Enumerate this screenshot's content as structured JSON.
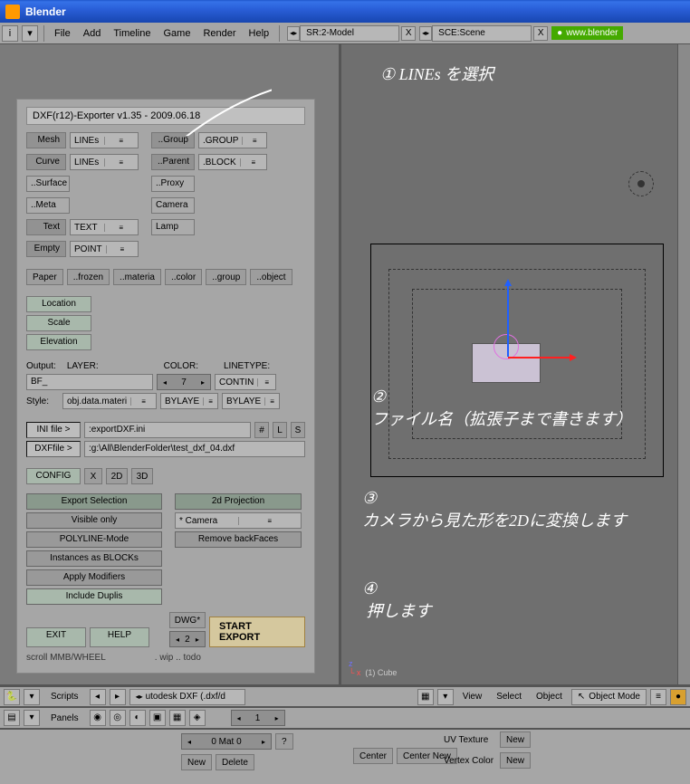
{
  "titlebar": {
    "title": "Blender"
  },
  "menu": {
    "items": [
      "File",
      "Add",
      "Timeline",
      "Game",
      "Render",
      "Help"
    ],
    "ibtn": "i",
    "scene1": "SR:2-Model",
    "scene2": "SCE:Scene",
    "url": "www.blender"
  },
  "panel": {
    "title": "DXF(r12)-Exporter  v1.35 - 2009.06.18",
    "mesh": "Mesh",
    "mesh_v": "LINEs",
    "curve": "Curve",
    "curve_v": "LINEs",
    "surface": "..Surface",
    "meta": "..Meta",
    "text": "Text",
    "text_v": "TEXT",
    "empty": "Empty",
    "empty_v": "POINT",
    "group": "..Group",
    "group_v": ".GROUP",
    "parent": "..Parent",
    "parent_v": ".BLOCK",
    "proxy": "..Proxy",
    "camera": "Camera",
    "lamp": "Lamp",
    "paper": "Paper",
    "frozen": "..frozen",
    "materia": "..materia",
    "color": "..color",
    "groupb": "..group",
    "object": "..object",
    "loc": "Location",
    "sca": "Scale",
    "ele": "Elevation",
    "out_lbl": "Output:",
    "layer": "LAYER:",
    "color_h": "COLOR:",
    "linetype": "LINETYPE:",
    "bf": "BF_",
    "colorv": "7",
    "contin": "CONTIN",
    "style": "Style:",
    "stylev": "obj.data.materi",
    "bylay1": "BYLAYE",
    "bylay2": "BYLAYE",
    "ini_btn": "INI file >",
    "ini_v": ":exportDXF.ini",
    "hash": "#",
    "l": "L",
    "s": "S",
    "dxf_btn": "DXFfile >",
    "dxf_v": ":g:\\All\\BlenderFolder\\test_dxf_04.dxf",
    "config": "CONFIG",
    "x": "X",
    "2d": "2D",
    "3d": "3D",
    "ex_sel": "Export Selection",
    "vis": "Visible only",
    "poly": "POLYLINE-Mode",
    "inst": "Instances as BLOCKs",
    "applym": "Apply Modifiers",
    "incd": "Include Duplis",
    "proj": "2d Projection",
    "cam": "* Camera",
    "backf": "Remove backFaces",
    "dwg": "DWG*",
    "two": "2",
    "start": "START EXPORT",
    "exit": "EXIT",
    "help": "HELP",
    "scroll": "scroll MMB/WHEEL",
    "wip": ". wip   .. todo"
  },
  "strip1": {
    "scripts": "Scripts",
    "menu_l": "utodesk DXF (.dxf/d",
    "view": "View",
    "select": "Select",
    "object": "Object",
    "mode": "Object Mode"
  },
  "strip2": {
    "panels": "Panels",
    "num": "1"
  },
  "bpanel": {
    "mat": "0 Mat 0",
    "new": "New",
    "delete": "Delete",
    "uv": "UV Texture",
    "vc": "Vertex Color",
    "center": "Center",
    "centern": "Center New"
  },
  "vp": {
    "obj": "(1) Cube"
  },
  "anno": {
    "a1": "① LINEs を選択",
    "a2": "②\nファイル名（拡張子まで書きます）",
    "a3": "③\nカメラから見た形を2Dに変換します",
    "a4": "④\n 押します"
  }
}
